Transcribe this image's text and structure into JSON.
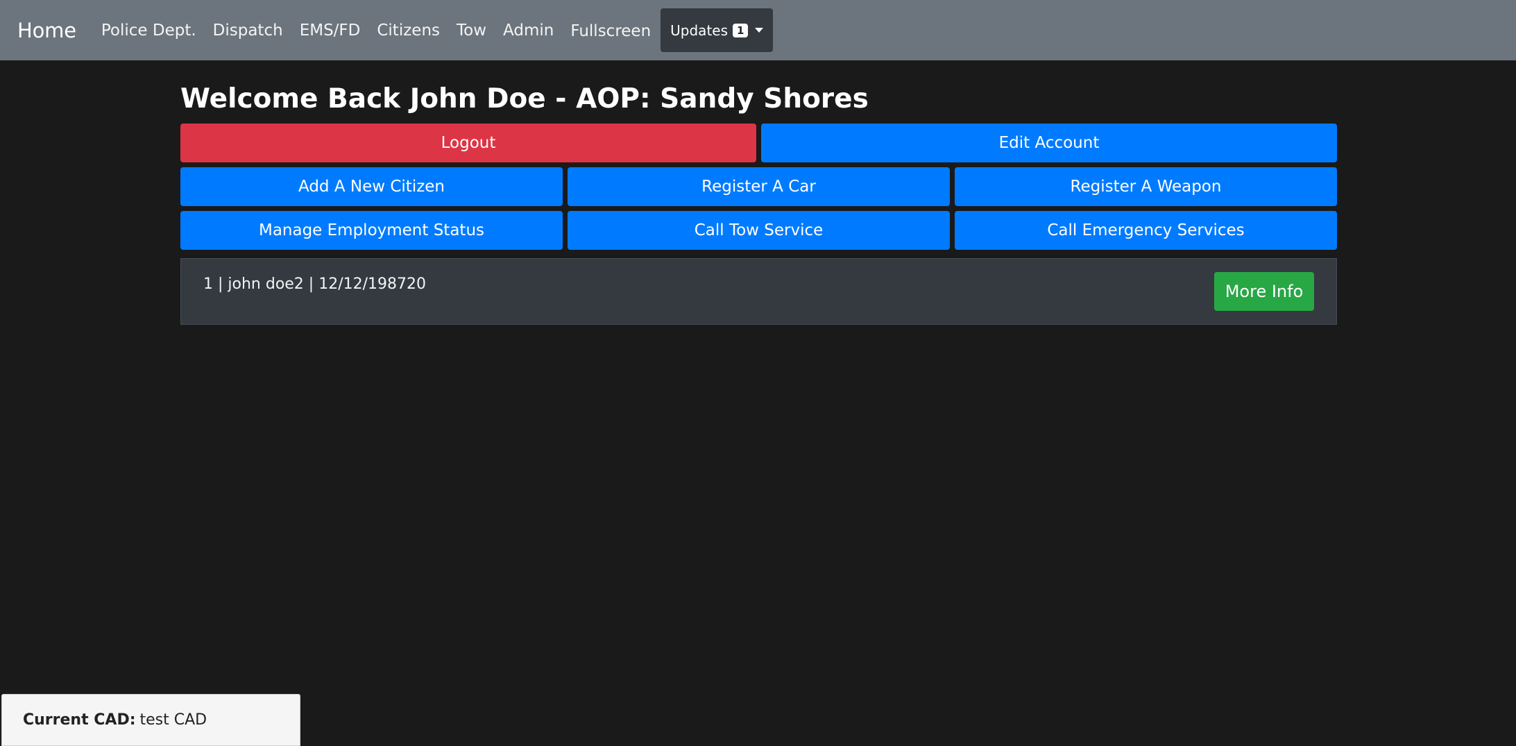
{
  "navbar": {
    "brand": "Home",
    "links": [
      {
        "label": "Police Dept."
      },
      {
        "label": "Dispatch"
      },
      {
        "label": "EMS/FD"
      },
      {
        "label": "Citizens"
      },
      {
        "label": "Tow"
      },
      {
        "label": "Admin"
      },
      {
        "label": "Fullscreen"
      }
    ],
    "updates": {
      "label": "Updates",
      "count": "1"
    }
  },
  "main": {
    "welcome": "Welcome Back John Doe - AOP: Sandy Shores",
    "buttons": {
      "logout": "Logout",
      "edit_account": "Edit Account",
      "add_citizen": "Add A New Citizen",
      "register_car": "Register A Car",
      "register_weapon": "Register A Weapon",
      "manage_employment": "Manage Employment Status",
      "call_tow": "Call Tow Service",
      "call_emergency": "Call Emergency Services"
    },
    "citizens": [
      {
        "summary": "1 | john doe2 | 12/12/198720",
        "action": "More Info"
      }
    ]
  },
  "footer": {
    "cad_label": "Current CAD:",
    "cad_value": "test CAD"
  },
  "colors": {
    "navbar": "#6c757d",
    "background": "#1a1a1a",
    "danger": "#dc3545",
    "primary": "#007bff",
    "success": "#28a745",
    "card": "#343a40"
  }
}
